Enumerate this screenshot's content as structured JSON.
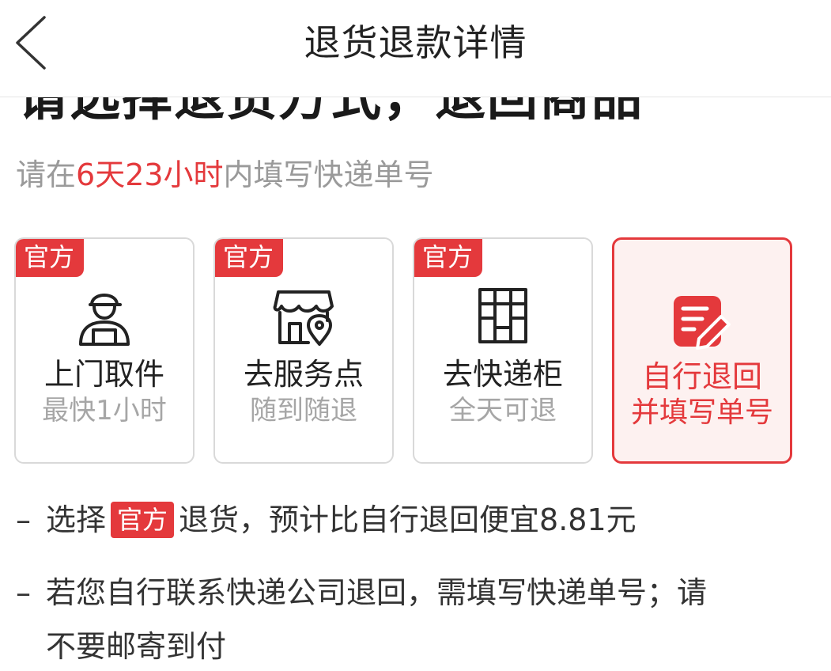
{
  "header": {
    "title": "退货退款详情"
  },
  "page": {
    "heading": "请选择退货方式，退回商品",
    "deadline_prefix": "请在",
    "deadline_time": "6天23小时",
    "deadline_suffix": "内填写快递单号"
  },
  "options": [
    {
      "badge": "官方",
      "title": "上门取件",
      "subtitle": "最快1小时",
      "icon": "courier-icon",
      "selected": false
    },
    {
      "badge": "官方",
      "title": "去服务点",
      "subtitle": "随到随退",
      "icon": "store-location-icon",
      "selected": false
    },
    {
      "badge": "官方",
      "title": "去快递柜",
      "subtitle": "全天可退",
      "icon": "locker-icon",
      "selected": false
    },
    {
      "title": "自行退回",
      "subtitle": "并填写单号",
      "icon": "edit-note-icon",
      "selected": true
    }
  ],
  "notes": {
    "dash": "–",
    "note1_prefix": "选择",
    "note1_badge": "官方",
    "note1_suffix": "退货，预计比自行退回便宜8.81元",
    "note2_line1": "若您自行联系快递公司退回，需填写快递单号；请",
    "note2_line2": "不要邮寄到付"
  },
  "colors": {
    "accent": "#e4393c",
    "muted": "#9a9a9a",
    "selected_bg": "#fdf1f0"
  }
}
